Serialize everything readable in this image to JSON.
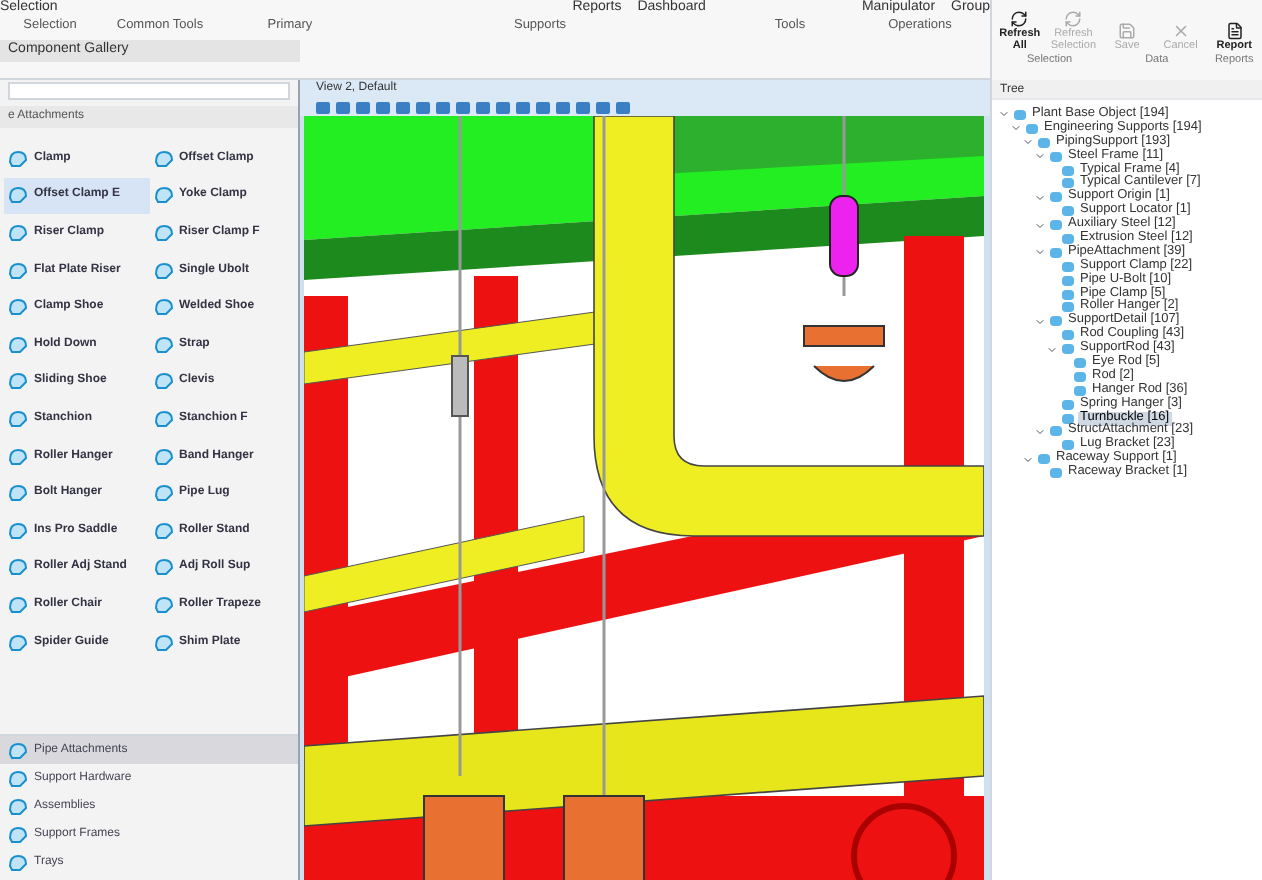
{
  "ribbon": {
    "top_items": [
      "Selection",
      "Reports",
      "Dashboard",
      "Manipulator",
      "Group"
    ],
    "groups": [
      "Selection",
      "Common Tools",
      "Primary",
      "Supports",
      "Tools",
      "Operations"
    ],
    "right_buttons": [
      {
        "label": "Refresh All",
        "disabled": false
      },
      {
        "label": "Refresh Selection",
        "disabled": true
      },
      {
        "label": "Save",
        "disabled": true
      },
      {
        "label": "Cancel",
        "disabled": true
      },
      {
        "label": "Report",
        "disabled": false
      }
    ],
    "right_groups": [
      "Selection",
      "Data",
      "Reports"
    ]
  },
  "gallery": {
    "title": "Component Gallery",
    "section": "e Attachments",
    "items": [
      {
        "label": "Clamp",
        "selected": false
      },
      {
        "label": "Offset Clamp",
        "selected": false
      },
      {
        "label": "Offset Clamp E",
        "selected": true
      },
      {
        "label": "Yoke Clamp",
        "selected": false
      },
      {
        "label": "Riser Clamp",
        "selected": false
      },
      {
        "label": "Riser Clamp F",
        "selected": false
      },
      {
        "label": "Flat Plate Riser",
        "selected": false
      },
      {
        "label": "Single Ubolt",
        "selected": false
      },
      {
        "label": "Clamp Shoe",
        "selected": false
      },
      {
        "label": "Welded Shoe",
        "selected": false
      },
      {
        "label": "Hold Down",
        "selected": false
      },
      {
        "label": "Strap",
        "selected": false
      },
      {
        "label": "Sliding Shoe",
        "selected": false
      },
      {
        "label": "Clevis",
        "selected": false
      },
      {
        "label": "Stanchion",
        "selected": false
      },
      {
        "label": "Stanchion F",
        "selected": false
      },
      {
        "label": "Roller Hanger",
        "selected": false
      },
      {
        "label": "Band Hanger",
        "selected": false
      },
      {
        "label": "Bolt Hanger",
        "selected": false
      },
      {
        "label": "Pipe Lug",
        "selected": false
      },
      {
        "label": "Ins Pro Saddle",
        "selected": false
      },
      {
        "label": "Roller Stand",
        "selected": false
      },
      {
        "label": "Roller Adj Stand",
        "selected": false
      },
      {
        "label": "Adj Roll Sup",
        "selected": false
      },
      {
        "label": "Roller Chair",
        "selected": false
      },
      {
        "label": "Roller Trapeze",
        "selected": false
      },
      {
        "label": "Spider Guide",
        "selected": false
      },
      {
        "label": "Shim Plate",
        "selected": false
      }
    ],
    "categories": [
      {
        "label": "Pipe Attachments",
        "selected": true
      },
      {
        "label": "Support Hardware",
        "selected": false
      },
      {
        "label": "Assemblies",
        "selected": false
      },
      {
        "label": "Support Frames",
        "selected": false
      },
      {
        "label": "Trays",
        "selected": false
      }
    ]
  },
  "view": {
    "title": "View 2, Default"
  },
  "tree": {
    "title": "Tree",
    "nodes": [
      {
        "label": "Plant Base Object [194]",
        "expanded": true,
        "selected": false,
        "children": [
          {
            "label": "Engineering Supports [194]",
            "expanded": true,
            "selected": false,
            "children": [
              {
                "label": "PipingSupport [193]",
                "expanded": true,
                "selected": false,
                "children": [
                  {
                    "label": "Steel Frame [11]",
                    "expanded": true,
                    "selected": false,
                    "children": [
                      {
                        "label": "Typical Frame [4]",
                        "selected": false
                      },
                      {
                        "label": "Typical Cantilever [7]",
                        "selected": false
                      }
                    ]
                  },
                  {
                    "label": "Support Origin [1]",
                    "expanded": true,
                    "selected": false,
                    "children": [
                      {
                        "label": "Support Locator [1]",
                        "selected": false
                      }
                    ]
                  },
                  {
                    "label": "Auxiliary Steel [12]",
                    "expanded": true,
                    "selected": false,
                    "children": [
                      {
                        "label": "Extrusion Steel [12]",
                        "selected": false
                      }
                    ]
                  },
                  {
                    "label": "PipeAttachment [39]",
                    "expanded": true,
                    "selected": false,
                    "children": [
                      {
                        "label": "Support Clamp [22]",
                        "selected": false
                      },
                      {
                        "label": "Pipe U-Bolt [10]",
                        "selected": false
                      },
                      {
                        "label": "Pipe Clamp [5]",
                        "selected": false
                      },
                      {
                        "label": "Roller Hanger [2]",
                        "selected": false
                      }
                    ]
                  },
                  {
                    "label": "SupportDetail [107]",
                    "expanded": true,
                    "selected": false,
                    "children": [
                      {
                        "label": "Rod Coupling [43]",
                        "selected": false
                      },
                      {
                        "label": "SupportRod [43]",
                        "expanded": true,
                        "selected": false,
                        "children": [
                          {
                            "label": "Eye Rod [5]",
                            "selected": false
                          },
                          {
                            "label": "Rod [2]",
                            "selected": false
                          },
                          {
                            "label": "Hanger Rod [36]",
                            "selected": false
                          }
                        ]
                      },
                      {
                        "label": "Spring Hanger [3]",
                        "selected": false
                      },
                      {
                        "label": "Turnbuckle [16]",
                        "selected": true
                      }
                    ]
                  },
                  {
                    "label": "StructAttachment [23]",
                    "expanded": true,
                    "selected": false,
                    "children": [
                      {
                        "label": "Lug Bracket [23]",
                        "selected": false
                      }
                    ]
                  }
                ]
              },
              {
                "label": "Raceway Support [1]",
                "expanded": true,
                "selected": false,
                "children": [
                  {
                    "label": "Raceway Bracket [1]",
                    "selected": false
                  }
                ]
              }
            ]
          }
        ]
      }
    ]
  }
}
